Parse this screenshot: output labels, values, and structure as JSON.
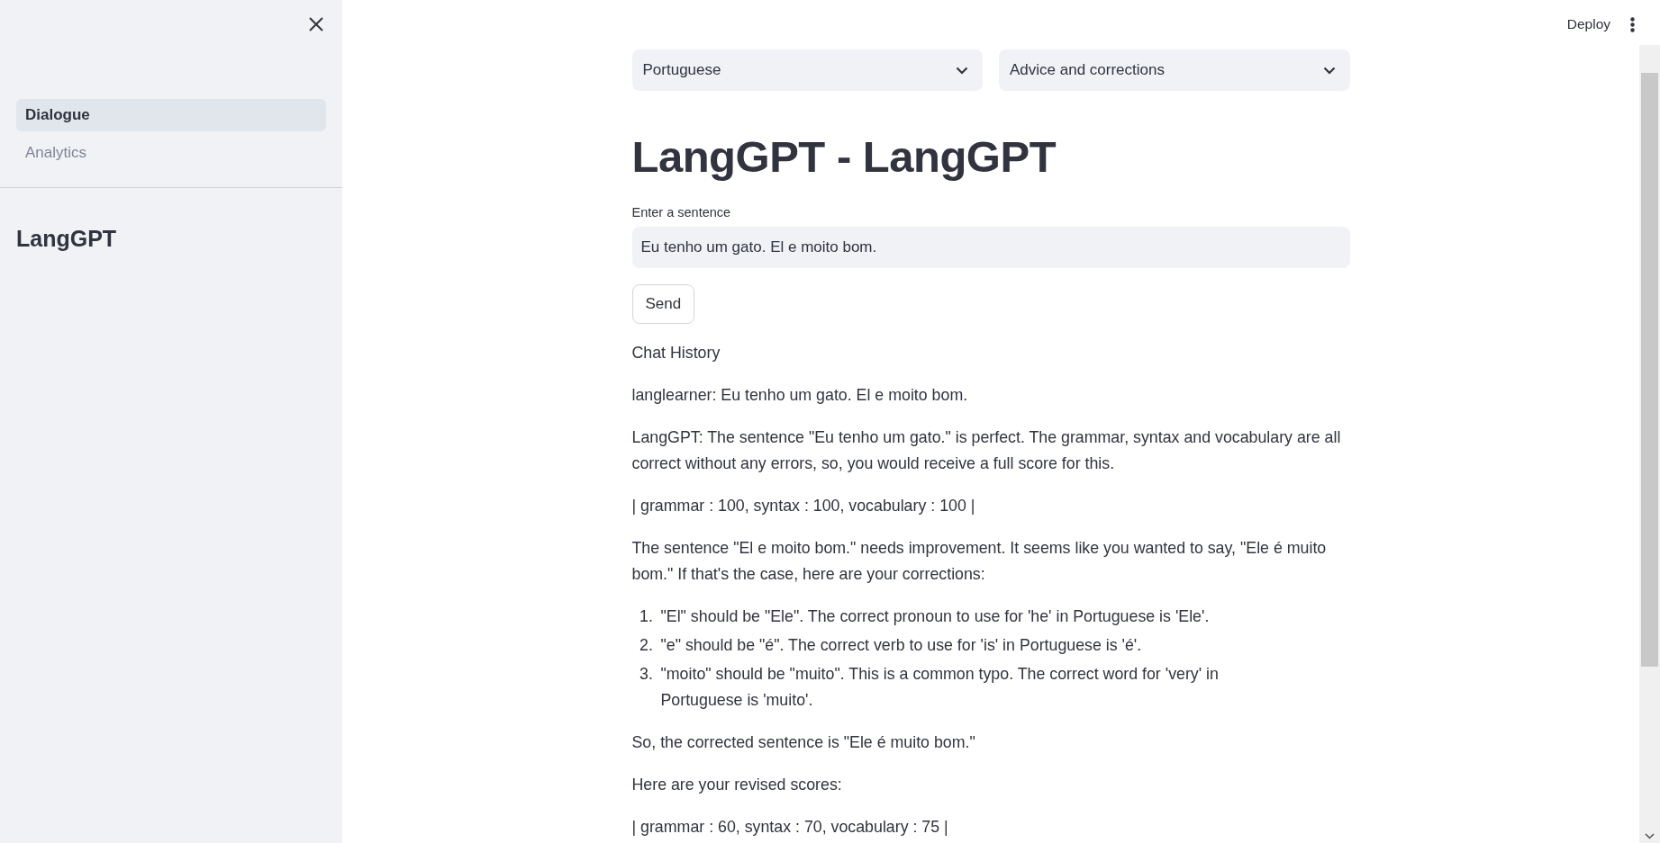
{
  "sidebar": {
    "nav_items": [
      {
        "label": "Dialogue",
        "selected": true
      },
      {
        "label": "Analytics",
        "selected": false
      }
    ],
    "title": "LangGPT"
  },
  "toolbar": {
    "deploy": "Deploy"
  },
  "selects": [
    {
      "value": "Portuguese"
    },
    {
      "value": "Advice and corrections"
    }
  ],
  "title": "LangGPT - LangGPT",
  "input": {
    "label": "Enter a sentence",
    "value": "Eu tenho um gato. El e moito bom."
  },
  "send_button": "Send",
  "chat_heading": "Chat History",
  "messages": [
    {
      "kind": "paragraph",
      "text": "langlearner: Eu tenho um gato. El e moito bom."
    },
    {
      "kind": "paragraph",
      "text": "LangGPT: The sentence \"Eu tenho um gato.\" is perfect. The grammar, syntax and vocabulary are all correct without any errors, so, you would receive a full score for this."
    },
    {
      "kind": "paragraph",
      "text": "| grammar : 100, syntax : 100, vocabulary : 100 |"
    },
    {
      "kind": "paragraph",
      "text": "The sentence \"El e moito bom.\" needs improvement. It seems like you wanted to say, \"Ele é muito bom.\" If that's the case, here are your corrections:"
    },
    {
      "kind": "list",
      "items": [
        {
          "number": "1.",
          "text": "\"El\" should be \"Ele\". The correct pronoun to use for 'he' in Portuguese is 'Ele'."
        },
        {
          "number": "2.",
          "text": "\"e\" should be \"é\". The correct verb to use for 'is' in Portuguese is 'é'."
        },
        {
          "number": "3.",
          "text": "\"moito\" should be \"muito\". This is a common typo. The correct word for 'very' in Portuguese is 'muito'."
        }
      ]
    },
    {
      "kind": "paragraph",
      "text": "So, the corrected sentence is \"Ele é muito bom.\""
    },
    {
      "kind": "paragraph",
      "text": "Here are your revised scores:"
    },
    {
      "kind": "paragraph",
      "text": "| grammar : 60, syntax : 70, vocabulary : 75 |"
    }
  ]
}
